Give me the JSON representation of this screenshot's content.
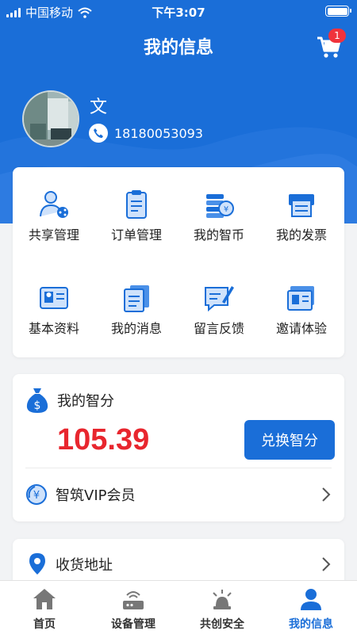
{
  "status_bar": {
    "carrier": "中国移动",
    "time": "下午3:07"
  },
  "nav": {
    "title": "我的信息",
    "cart_badge": "1"
  },
  "profile": {
    "name": "文",
    "phone": "18180053093"
  },
  "menu": [
    {
      "label": "共享管理",
      "icon": "share-users-icon"
    },
    {
      "label": "订单管理",
      "icon": "order-clipboard-icon"
    },
    {
      "label": "我的智币",
      "icon": "coin-stack-icon"
    },
    {
      "label": "我的发票",
      "icon": "invoice-printer-icon"
    },
    {
      "label": "基本资料",
      "icon": "id-card-icon"
    },
    {
      "label": "我的消息",
      "icon": "message-docs-icon"
    },
    {
      "label": "留言反馈",
      "icon": "feedback-pen-icon"
    },
    {
      "label": "邀请体验",
      "icon": "invite-ticket-icon"
    }
  ],
  "score": {
    "label": "我的智分",
    "value": "105.39",
    "exchange_label": "兑换智分",
    "vip_label": "智筑VIP会员"
  },
  "address": {
    "label": "收货地址"
  },
  "tabs": [
    {
      "label": "首页",
      "icon": "home-icon"
    },
    {
      "label": "设备管理",
      "icon": "router-device-icon"
    },
    {
      "label": "共创安全",
      "icon": "safety-light-icon"
    },
    {
      "label": "我的信息",
      "icon": "person-icon",
      "active": true
    }
  ],
  "colors": {
    "primary": "#1a6ed8",
    "score_red": "#e8262e",
    "badge_red": "#f0323c"
  }
}
